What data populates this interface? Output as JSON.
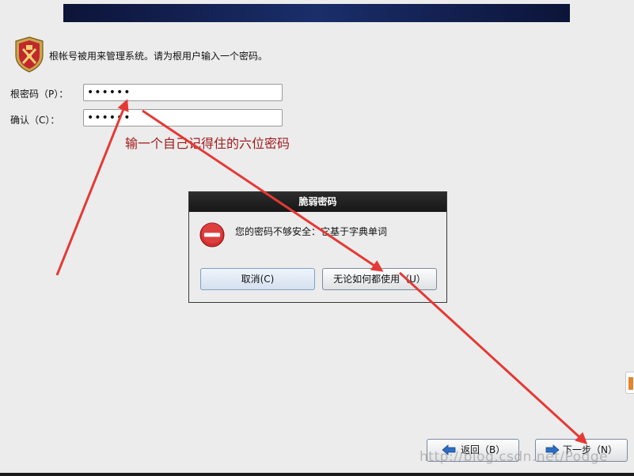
{
  "intro": {
    "text": "根帐号被用来管理系统。请为根用户输入一个密码。"
  },
  "form": {
    "root_label": "根密码（P）：",
    "root_value": "••••••",
    "confirm_label": "确认（C）：",
    "confirm_value": "••••••"
  },
  "annotation": "输一个自己记得住的六位密码",
  "dialog": {
    "title": "脆弱密码",
    "message": "您的密码不够安全：它基于字典单词",
    "cancel_label": "取消(C)",
    "use_label": "无论如何都使用（U）"
  },
  "nav": {
    "back_label": "返回（B）",
    "next_label": "下一步（N）"
  },
  "watermark": "http://blog.csdn.net/Podge",
  "colors": {
    "annotation_red": "#e53935",
    "title_bar": "#1c1c1c",
    "stop_icon": "#d32f2f",
    "nav_arrow": "#2c6cc4"
  }
}
